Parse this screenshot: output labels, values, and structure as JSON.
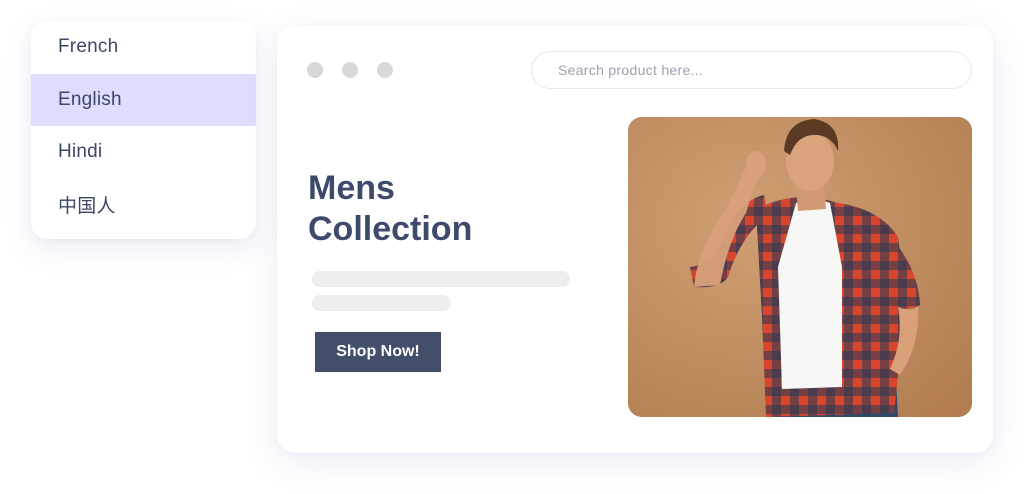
{
  "language_menu": {
    "items": [
      {
        "label": "French",
        "selected": false
      },
      {
        "label": "English",
        "selected": true
      },
      {
        "label": "Hindi",
        "selected": false
      },
      {
        "label": "中国人",
        "selected": false
      }
    ],
    "selected_color": "#dedcff"
  },
  "browser": {
    "window_dots": 3,
    "search": {
      "placeholder": "Search product here...",
      "value": ""
    },
    "hero": {
      "title_line1": "Mens",
      "title_line2": "Collection",
      "cta_label": "Shop Now!"
    },
    "image": {
      "subject": "man in red plaid shirt over white t-shirt and jeans"
    }
  },
  "colors": {
    "title": "#3d4a6b",
    "button_bg": "#434e6b",
    "photo_bg": "#c0895a",
    "skeleton": "#ededee"
  }
}
